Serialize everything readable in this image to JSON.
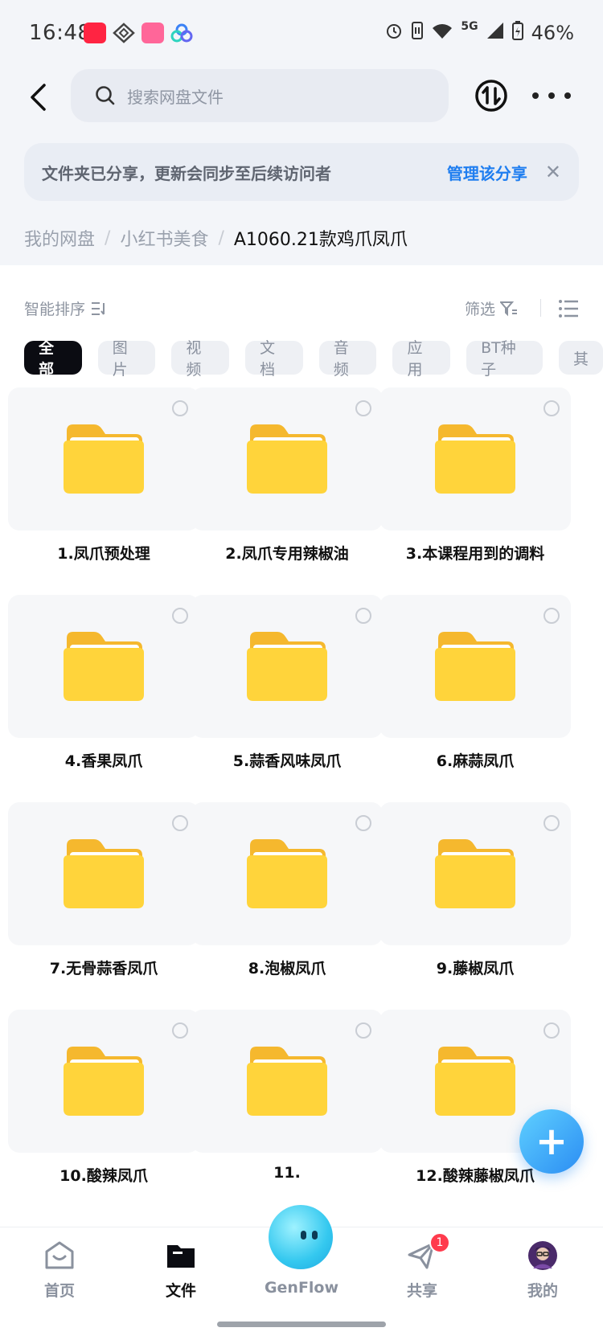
{
  "status_bar": {
    "time": "16:48",
    "network": "5G",
    "battery": "46%",
    "apps": [
      "xiaohongshu-icon",
      "diamond-app-icon",
      "bilibili-icon",
      "cloud-app-icon"
    ]
  },
  "header": {
    "search_placeholder": "搜索网盘文件"
  },
  "banner": {
    "message": "文件夹已分享，更新会同步至后续访问者",
    "action": "管理该分享"
  },
  "breadcrumb": {
    "items": [
      "我的网盘",
      "小红书美食"
    ],
    "current": "A1060.21款鸡爪凤爪"
  },
  "toolbar": {
    "sort_label": "智能排序",
    "filter_label": "筛选"
  },
  "categories": [
    {
      "label": "全部",
      "active": true
    },
    {
      "label": "图片"
    },
    {
      "label": "视频"
    },
    {
      "label": "文档"
    },
    {
      "label": "音频"
    },
    {
      "label": "应用"
    },
    {
      "label": "BT种子"
    },
    {
      "label": "其"
    }
  ],
  "folders": [
    "1.凤爪预处理",
    "2.凤爪专用辣椒油",
    "3.本课程用到的调料",
    "4.香果凤爪",
    "5.蒜香风味凤爪",
    "6.麻蒜凤爪",
    "7.无骨蒜香凤爪",
    "8.泡椒凤爪",
    "9.藤椒凤爪",
    "10.酸辣凤爪",
    "11.",
    "12.酸辣藤椒凤爪"
  ],
  "nav": {
    "home": "首页",
    "files": "文件",
    "genflow": "GenFlow",
    "share": "共享",
    "share_badge": "1",
    "mine": "我的"
  },
  "colors": {
    "accent": "#1f7ef0",
    "folder": "#ffd43b",
    "badge": "#ff3b4d"
  }
}
